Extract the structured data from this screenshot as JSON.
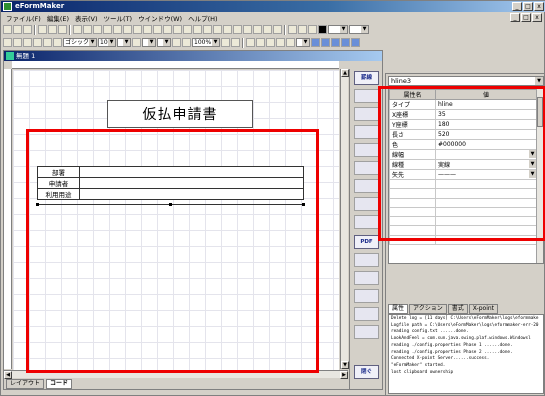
{
  "window": {
    "title": "eFormMaker",
    "min": "_",
    "max": "□",
    "close": "x"
  },
  "menu": [
    "ファイル(F)",
    "編集(E)",
    "表示(V)",
    "ツール(T)",
    "ウインドウ(W)",
    "ヘルプ(H)"
  ],
  "toolbar": {
    "font": "ゴシック",
    "size": "10",
    "zoom": "100%"
  },
  "child": {
    "title": "無題 1"
  },
  "form": {
    "title": "仮払申請書",
    "rows": [
      "部署",
      "申請者",
      "利用用途"
    ]
  },
  "toolbox": [
    "罫線",
    "",
    "",
    "",
    "",
    "",
    "",
    "",
    "",
    "PDF",
    "",
    "",
    "",
    "",
    "",
    "閉ぐ"
  ],
  "tabs": {
    "layout": "レイアウト",
    "code": "コード"
  },
  "properties": {
    "selected": "hline3",
    "header": {
      "name": "属性名",
      "value": "値"
    },
    "rows": [
      {
        "key": "タイプ",
        "value": "hline"
      },
      {
        "key": "X座標",
        "value": "35"
      },
      {
        "key": "Y座標",
        "value": "180"
      },
      {
        "key": "長さ",
        "value": "520"
      },
      {
        "key": "色",
        "value": "#000000"
      },
      {
        "key": "線幅",
        "value": ""
      },
      {
        "key": "線種",
        "value": "実線"
      },
      {
        "key": "矢先",
        "value": "———"
      }
    ],
    "tabs": [
      "属性",
      "アクション",
      "書式",
      "X-point"
    ]
  },
  "log": [
    "Delete log = [11 days] C:\\Users\\eFormMaker\\logs\\eformmake",
    "Logfile path = C:\\Users\\eFormMaker\\logs\\eformmaker-err-20",
    "reading config.txt ......done.",
    "  LookAndFeel  = com.sun.java.swing.plaf.windows.Windowsl",
    "reading ./config.properties Phase 1 ......done.",
    "reading ./config.properties Phase 2 ......done.",
    "Connected X-point Server......success.",
    "\"eFormMaker\" started.",
    "lost clipboard ownership"
  ],
  "colors": {
    "highlight": "#ee0000",
    "title_bar": "#0a246a"
  }
}
